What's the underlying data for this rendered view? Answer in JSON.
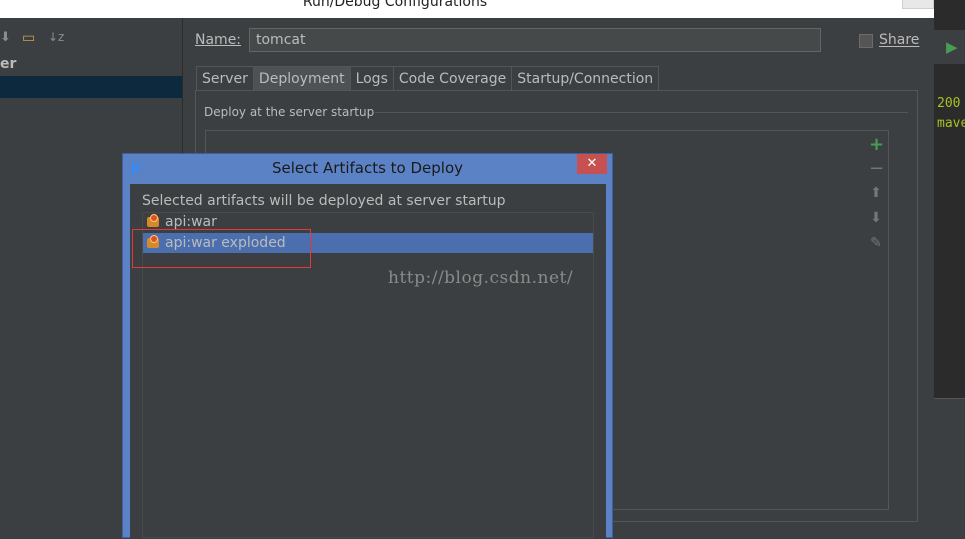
{
  "window": {
    "title": "Run/Debug Configurations"
  },
  "left_pane": {
    "tree_item_1": "er"
  },
  "name_row": {
    "label": "Name:",
    "value": "tomcat",
    "share_label": "Share"
  },
  "tabs": [
    {
      "label": "Server"
    },
    {
      "label": "Deployment",
      "active": true
    },
    {
      "label": "Logs"
    },
    {
      "label": "Code Coverage"
    },
    {
      "label": "Startup/Connection"
    }
  ],
  "deployment": {
    "section_label": "Deploy at the server startup",
    "side_tools": [
      "add-icon",
      "remove-icon",
      "move-up-icon",
      "move-down-icon",
      "edit-icon"
    ]
  },
  "right_strip": {
    "code_line_1": "200",
    "code_line_2": "mave"
  },
  "dialog": {
    "icon_text": "JI",
    "title": "Select Artifacts to Deploy",
    "close_label": "✕",
    "description": "Selected artifacts will be deployed at server startup",
    "artifacts": [
      {
        "label": "api:war",
        "selected": false
      },
      {
        "label": "api:war exploded",
        "selected": true
      }
    ]
  },
  "watermark": "http://blog.csdn.net/",
  "colors": {
    "selection": "#4b6eaf",
    "dialog_frame": "#5c82c6",
    "highlight": "#e53935",
    "add": "#499c54"
  }
}
